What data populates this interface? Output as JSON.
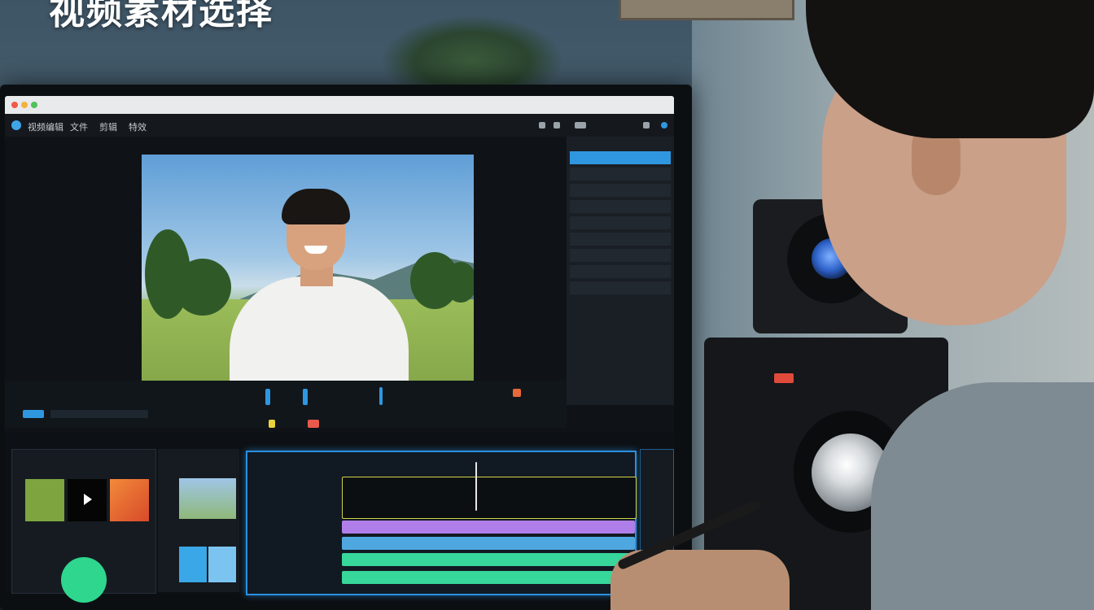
{
  "headline": "视频素材选择",
  "app": {
    "window_title": "",
    "menu": [
      "视频编辑",
      "文件",
      "剪辑",
      "特效"
    ]
  },
  "right_panel": {
    "title": "",
    "items": [
      "",
      "",
      "",
      "",
      "",
      "",
      "",
      "",
      ""
    ]
  },
  "lower": {
    "library_title": "",
    "media_title": ""
  },
  "colors": {
    "accent": "#2f97e0",
    "track_purple": "#b07ee8",
    "track_green": "#37d69a",
    "track_blue": "#4fa7e0"
  }
}
